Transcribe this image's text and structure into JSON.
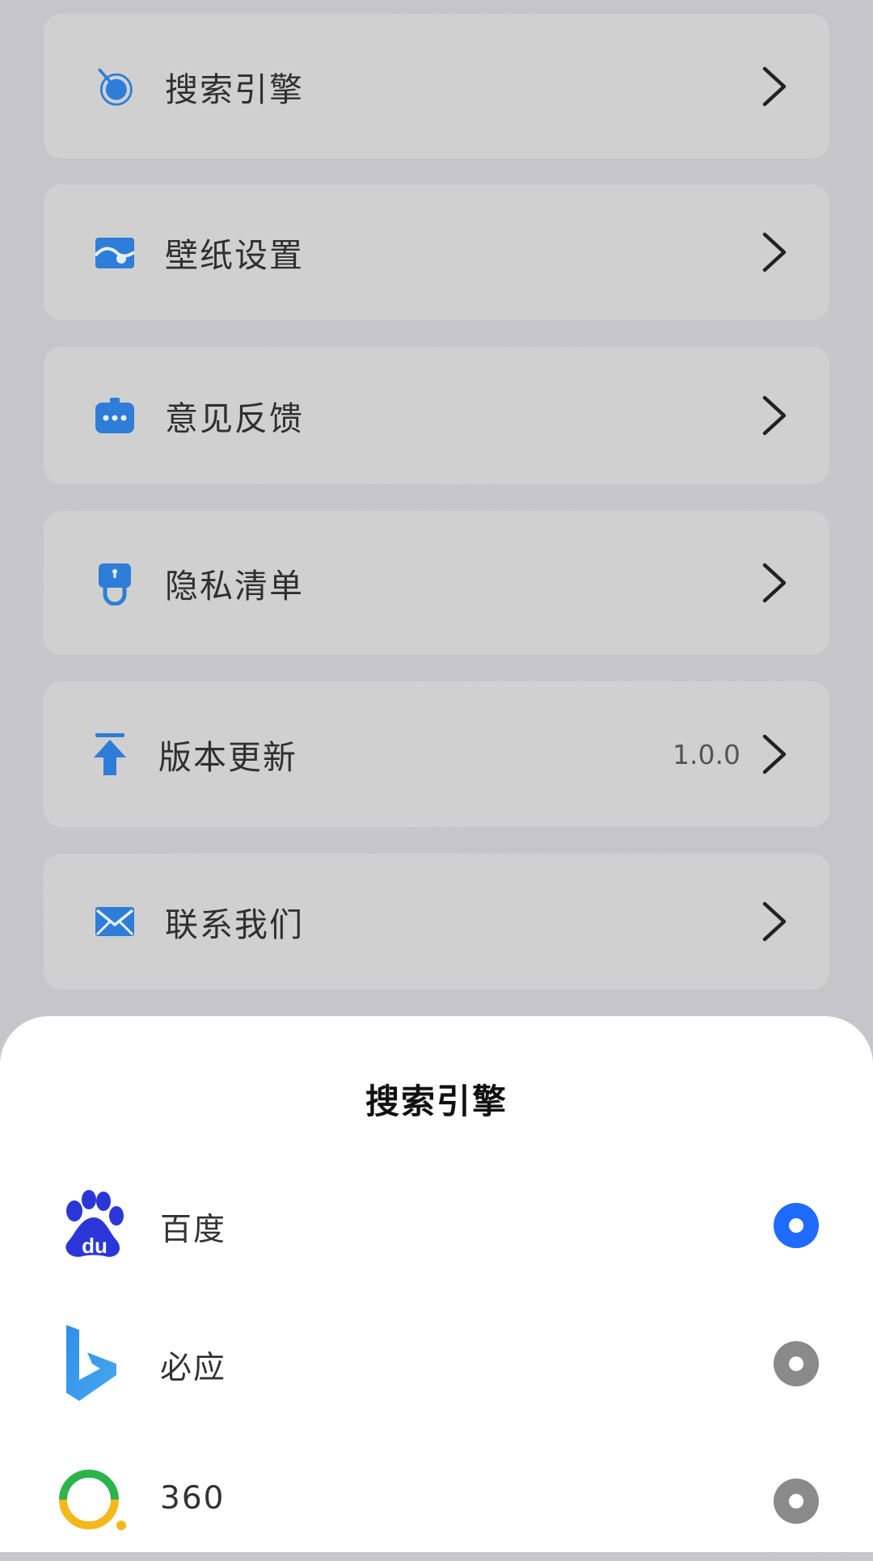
{
  "colors": {
    "accent": "#1F6BFF",
    "icon_blue": "#2E7DD8",
    "radio_off": "#8A8A8A"
  },
  "menu": [
    {
      "label": "搜索引擎",
      "icon": "search-engine-icon",
      "value": ""
    },
    {
      "label": "壁纸设置",
      "icon": "wallpaper-icon",
      "value": ""
    },
    {
      "label": "意见反馈",
      "icon": "feedback-icon",
      "value": ""
    },
    {
      "label": "隐私清单",
      "icon": "privacy-icon",
      "value": ""
    },
    {
      "label": "版本更新",
      "icon": "update-icon",
      "value": "1.0.0"
    },
    {
      "label": "联系我们",
      "icon": "mail-icon",
      "value": ""
    }
  ],
  "sheet": {
    "title": "搜索引擎",
    "engines": [
      {
        "name": "百度",
        "icon": "baidu-logo-icon",
        "selected": true
      },
      {
        "name": "必应",
        "icon": "bing-logo-icon",
        "selected": false
      },
      {
        "name": "360",
        "icon": "360-logo-icon",
        "selected": false
      }
    ]
  }
}
